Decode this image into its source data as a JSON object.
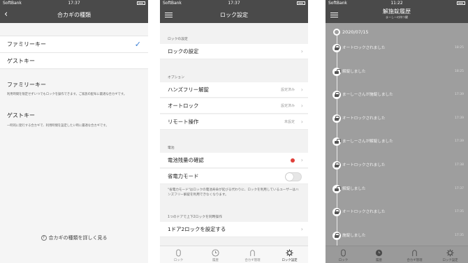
{
  "screen1": {
    "status": {
      "carrier": "SoftBank",
      "time": "17:37"
    },
    "title": "合カギの種類",
    "back_icon": "chevron-left-icon",
    "options": [
      {
        "label": "ファミリーキー",
        "selected": true
      },
      {
        "label": "ゲストキー",
        "selected": false
      }
    ],
    "sections": [
      {
        "heading": "ファミリーキー",
        "desc": "利用時間を限定せずいつでもロックを操作できます。ご家族の配布に最適な合カギです。"
      },
      {
        "heading": "ゲストキー",
        "desc": "一時的に発行する合カギで、利用時間を設定したい時に最適な合カギです。"
      }
    ],
    "help_link": "合カギの種類を詳しく見る"
  },
  "screen2": {
    "status": {
      "carrier": "SoftBank",
      "time": "17:37"
    },
    "title": "ロック設定",
    "sections": [
      {
        "label": "ロックの設定",
        "rows": [
          {
            "label": "ロックの設定",
            "value": ""
          }
        ]
      },
      {
        "label": "オプション",
        "rows": [
          {
            "label": "ハンズフリー解錠",
            "value": "設定済み"
          },
          {
            "label": "オートロック",
            "value": "設定済み"
          },
          {
            "label": "リモート操作",
            "value": "未設定"
          }
        ]
      },
      {
        "label": "電池",
        "rows": [
          {
            "label": "電池残量の確認",
            "value": ""
          },
          {
            "label": "省電力モード",
            "value": ""
          }
        ]
      },
      {
        "label": "1つのドアで上下2ロックを同時操作",
        "rows": [
          {
            "label": "1ドア2ロックを設定する",
            "value": ""
          }
        ]
      }
    ],
    "power_note": "\"省電力モード\"はロックの電池寿命が延びる代わりに、ロックを利用しているユーザーはハンズフリー解錠を利用できなくなります。",
    "tabs": [
      {
        "label": "ロック",
        "icon": "lock-icon"
      },
      {
        "label": "履歴",
        "icon": "clock-icon"
      },
      {
        "label": "合カギ管理",
        "icon": "key-icon"
      },
      {
        "label": "ロック設定",
        "icon": "gear-icon"
      }
    ]
  },
  "screen3": {
    "status": {
      "carrier": "SoftBank",
      "time": "11:22"
    },
    "title": "解施錠履歴",
    "subtitle": "まーしーの持つ鍵",
    "date": "2020/07/15",
    "entries": [
      {
        "msg": "オートロックされました",
        "time": "18:25",
        "lock": "closed"
      },
      {
        "msg": "解錠しました",
        "time": "18:25",
        "lock": "open"
      },
      {
        "msg": "まーしーさんが施錠しました",
        "time": "17:39",
        "lock": "closed"
      },
      {
        "msg": "オートロックされました",
        "time": "17:39",
        "lock": "closed"
      },
      {
        "msg": "まーしーさんが解錠しました",
        "time": "17:39",
        "lock": "open"
      },
      {
        "msg": "オートロックされました",
        "time": "17:38",
        "lock": "closed"
      },
      {
        "msg": "解錠しました",
        "time": "17:37",
        "lock": "open"
      },
      {
        "msg": "オートロックされました",
        "time": "17:35",
        "lock": "closed"
      },
      {
        "msg": "施錠しました",
        "time": "17:35",
        "lock": "closed"
      }
    ],
    "tabs": [
      {
        "label": "ロック",
        "icon": "lock-icon"
      },
      {
        "label": "履歴",
        "icon": "clock-icon"
      },
      {
        "label": "合カギ管理",
        "icon": "key-icon"
      },
      {
        "label": "ロック設定",
        "icon": "gear-icon"
      }
    ]
  },
  "colors": {
    "nav": "#4a4a4a",
    "accent": "#3a7fd5",
    "alert": "#e0403a"
  }
}
